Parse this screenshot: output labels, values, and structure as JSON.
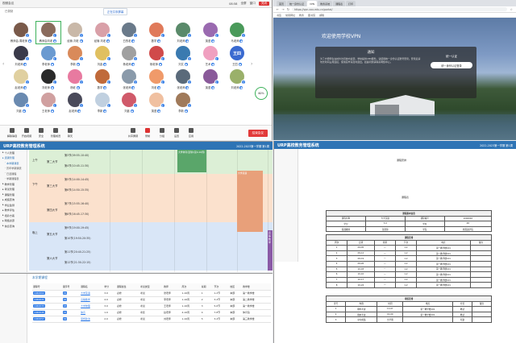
{
  "meeting": {
    "title_left": "视频会议",
    "title_time": "08:58",
    "title_buttons": [
      "全屏",
      "窗口",
      "关闭"
    ],
    "subtitle": "已录制",
    "notice": "正在共享屏幕",
    "participants": [
      {
        "name": "教师会-周老师",
        "color": "#7a5a4a",
        "badge": "主",
        "selected": false
      },
      {
        "name": "教师会刘老",
        "color": "#8a6b5c",
        "badge": "主",
        "selected": true
      },
      {
        "name": "经管-刘老",
        "color": "#c9b8a8",
        "badge": "主",
        "selected": false
      },
      {
        "name": "经管-刘老",
        "color": "#d9a0a8",
        "badge": "主",
        "selected": false
      },
      {
        "name": "白的老",
        "color": "#6a7a8a",
        "badge": "主",
        "selected": false
      },
      {
        "name": "数学",
        "color": "#e07a5a",
        "badge": "主",
        "selected": false
      },
      {
        "name": "刘老师",
        "color": "#5a8a6a",
        "badge": "主",
        "selected": false
      },
      {
        "name": "英语",
        "color": "#9a6ab0",
        "badge": "主",
        "selected": false
      },
      {
        "name": "马老师",
        "color": "#4a9a5a",
        "badge": "主",
        "selected": false
      },
      {
        "name": "刘老师",
        "color": "#3a3a4a",
        "badge": "主",
        "selected": false
      },
      {
        "name": "李老师",
        "color": "#6a9ad0",
        "badge": "主",
        "selected": false
      },
      {
        "name": "李新",
        "color": "#d98a5a",
        "badge": "主",
        "selected": false
      },
      {
        "name": "刘鑫",
        "color": "#e0c060",
        "badge": "主",
        "selected": false
      },
      {
        "name": "杨老师",
        "color": "#a0a0a0",
        "badge": "主",
        "selected": false
      },
      {
        "name": "杨老师",
        "color": "#d04a4a",
        "badge": "主",
        "selected": false
      },
      {
        "name": "刘文",
        "color": "#3a7ab0",
        "badge": "主",
        "selected": false
      },
      {
        "name": "艺术",
        "color": "#f0a0c0",
        "badge": "主",
        "selected": false
      },
      {
        "name": "王四",
        "color": "#3a6ad0",
        "badge": "主",
        "selected": false,
        "initials": "王四"
      },
      {
        "name": "赵老师",
        "color": "#e0d0a0",
        "badge": "主",
        "selected": false
      },
      {
        "name": "刘老师",
        "color": "#2a2a2a",
        "badge": "主",
        "selected": false
      },
      {
        "name": "杨老",
        "color": "#e87aa0",
        "badge": "主",
        "selected": false
      },
      {
        "name": "数学",
        "color": "#c06a3a",
        "badge": "主",
        "selected": false
      },
      {
        "name": "张老师",
        "color": "#8a9aaa",
        "badge": "主",
        "selected": false
      },
      {
        "name": "刘老",
        "color": "#f09a6a",
        "badge": "主",
        "selected": false
      },
      {
        "name": "张老师",
        "color": "#5a6a7a",
        "badge": "主",
        "selected": false
      },
      {
        "name": "英语",
        "color": "#8a5a9a",
        "badge": "主",
        "selected": false
      },
      {
        "name": "刘老师",
        "color": "#9ab06a",
        "badge": "主",
        "selected": false
      },
      {
        "name": "刘鑫",
        "color": "#6a8ab0",
        "badge": "主",
        "selected": false
      },
      {
        "name": "王老师",
        "color": "#d0a0a0",
        "badge": "主",
        "selected": false
      },
      {
        "name": "赵老师",
        "color": "#4a4a5a",
        "badge": "主",
        "selected": false
      },
      {
        "name": "李新",
        "color": "#c0d0e0",
        "badge": "主",
        "selected": false
      },
      {
        "name": "刘鑫",
        "color": "#d05a6a",
        "badge": "主",
        "selected": false
      },
      {
        "name": "英语",
        "color": "#f0c0a0",
        "badge": "主",
        "selected": false
      },
      {
        "name": "李新",
        "color": "#a07a5a",
        "badge": "主",
        "selected": false
      }
    ],
    "net_status": "60%",
    "toolbar": [
      {
        "label": "解除静音",
        "red": false
      },
      {
        "label": "开启视频",
        "red": false
      },
      {
        "label": "安全",
        "red": false
      },
      {
        "label": "管理成员",
        "red": false
      },
      {
        "label": "聊天",
        "red": false
      },
      {
        "label": "共享屏幕",
        "red": false
      },
      {
        "label": "录制",
        "red": true
      },
      {
        "label": "分组",
        "red": false
      },
      {
        "label": "设置",
        "red": false
      },
      {
        "label": "应用",
        "red": false
      }
    ],
    "end_button": "结束会议"
  },
  "browser": {
    "tabs": [
      "首页",
      "统一身份认证",
      "VPN",
      "教务系统",
      "课程表",
      "打印"
    ],
    "active_tab": 2,
    "url": "https://vpn.xxx.edu.cn/portal/",
    "bookmarks": [
      "书签",
      "常用网址",
      "教务",
      "图书馆",
      "邮箱"
    ],
    "vpn_title": "欢迎使用学校VPN",
    "notice_title": "通知",
    "notice_text": "为了方便师生在校外访问校内资源，学校提供VPN服务。请使用统一身份认证账号登录。登录后请勿长时间占用连接，使用完毕请及时退出。如遇问题请联系网络中心。",
    "login_title": "统一认证",
    "login_button": "统一身份认证登录"
  },
  "urp": {
    "logo": "URP高校教务管理系统",
    "term": "2022-2023第一学期 第1周",
    "sidebar": [
      {
        "label": "个人管理",
        "sub": false,
        "hi": false
      },
      {
        "label": "选课管理",
        "sub": false,
        "hi": true
      },
      {
        "label": "本学期课表",
        "sub": true,
        "hi": true
      },
      {
        "label": "历年学期课表",
        "sub": true,
        "hi": false
      },
      {
        "label": "已选课程",
        "sub": true,
        "hi": false
      },
      {
        "label": "学期课程表",
        "sub": true,
        "hi": false
      },
      {
        "label": "教学管理",
        "sub": false,
        "hi": false
      },
      {
        "label": "考试管理",
        "sub": false,
        "hi": false
      },
      {
        "label": "课程管理",
        "sub": false,
        "hi": false
      },
      {
        "label": "成绩查询",
        "sub": false,
        "hi": false
      },
      {
        "label": "学业监测",
        "sub": false,
        "hi": false
      },
      {
        "label": "教学评估",
        "sub": false,
        "hi": false
      },
      {
        "label": "培养方案",
        "sub": false,
        "hi": false
      },
      {
        "label": "网络资源",
        "sub": false,
        "hi": false
      },
      {
        "label": "信息查询",
        "sub": false,
        "hi": false
      }
    ],
    "sections": [
      {
        "period": "上午",
        "label": "第二大节",
        "slots": [
          "第3节(09:55-10:40)",
          "第4节(10:45-11:30)"
        ],
        "color": "#dcefd6"
      },
      {
        "period": "下午",
        "label": "第三大节",
        "slots": [
          "第5节(14:00-14:45)",
          "第6节(14:50-15:35)"
        ],
        "color": "#fbe1cd"
      },
      {
        "period": "",
        "label": "第四大节",
        "slots": [
          "第7节(15:55-16:40)",
          "第8节(16:45-17:30)"
        ],
        "color": "#fbe1cd"
      },
      {
        "period": "晚上",
        "label": "第五大节",
        "slots": [
          "第9节(19:00-19:45)",
          "第10节(19:50-20:35)"
        ],
        "color": "#d9e6f7"
      },
      {
        "period": "",
        "label": "第六大节",
        "slots": [
          "第11节(20:40-21:25)",
          "第12节(21:30-22:15)"
        ],
        "color": "#d9e6f7"
      }
    ],
    "courses": [
      {
        "title": "大学体育(篮球)(第4-16周)",
        "color": "#5aa66a"
      },
      {
        "title": "大学英语",
        "color": "#e8a07a"
      },
      {
        "title": "高等数学",
        "color": "#8a5aa6"
      }
    ]
  },
  "course_list": {
    "title": "本学期课程",
    "headers": [
      "课程号",
      "课序号",
      "课程名",
      "学分",
      "课程属性",
      "考试类型",
      "教师",
      "周次",
      "星期",
      "节次",
      "校区",
      "教学楼"
    ],
    "rows": [
      [
        "1040002",
        "01",
        "大学英语",
        "3.0",
        "必修",
        "考试",
        "张老师",
        "1-16周",
        "1",
        "1-2节",
        "本部",
        "第一教学楼"
      ],
      [
        "1040021",
        "02",
        "高等数学",
        "4.0",
        "必修",
        "考试",
        "李老师",
        "1-16周",
        "2",
        "3-4节",
        "本部",
        "第二教学楼"
      ],
      [
        "1040033",
        "03",
        "大学物理",
        "3.0",
        "必修",
        "考试",
        "王老师",
        "1-16周",
        "3",
        "5-6节",
        "本部",
        "第一教学楼"
      ],
      [
        "1040045",
        "01",
        "体育",
        "1.0",
        "必修",
        "考查",
        "赵老师",
        "4-16周",
        "4",
        "7-8节",
        "本部",
        "体育馆"
      ],
      [
        "1040057",
        "02",
        "思想政治",
        "2.0",
        "必修",
        "考试",
        "刘老师",
        "1-16周",
        "5",
        "3-4节",
        "本部",
        "第三教学楼"
      ]
    ]
  },
  "document": {
    "logo": "URP高校教务管理系统",
    "term": "2022-2023第一学期 第1周",
    "header_line": "课程安排",
    "subhead": "课程表",
    "table1": {
      "title": "课程基本信息",
      "rows": [
        [
          "课程名称",
          "大学英语",
          "课程编号",
          "1040002"
        ],
        [
          "学分",
          "3.0",
          "学时",
          "48"
        ],
        [
          "授课教师",
          "张老师",
          "学院",
          "外国语学院"
        ]
      ]
    },
    "table2": {
      "title": "课程安排",
      "headers": [
        "周次",
        "日期",
        "星期",
        "节次",
        "地点",
        "备注"
      ],
      "rows": [
        [
          "1",
          "09-05",
          "一",
          "1-2",
          "第一教学楼101",
          ""
        ],
        [
          "2",
          "09-12",
          "一",
          "1-2",
          "第一教学楼101",
          ""
        ],
        [
          "3",
          "09-19",
          "一",
          "1-2",
          "第一教学楼101",
          ""
        ],
        [
          "4",
          "09-26",
          "一",
          "1-2",
          "第一教学楼101",
          ""
        ],
        [
          "5",
          "10-03",
          "一",
          "1-2",
          "第一教学楼101",
          ""
        ],
        [
          "6",
          "10-10",
          "一",
          "1-2",
          "第一教学楼101",
          ""
        ],
        [
          "7",
          "10-17",
          "一",
          "1-2",
          "第一教学楼101",
          ""
        ],
        [
          "8",
          "10-24",
          "一",
          "1-2",
          "第一教学楼101",
          ""
        ]
      ]
    },
    "table3": {
      "title": "考核安排",
      "headers": [
        "序号",
        "内容",
        "时间",
        "地点",
        "方式",
        "备注"
      ],
      "rows": [
        [
          "1",
          "期中考试",
          "11-07",
          "第一教学楼101",
          "笔试",
          ""
        ],
        [
          "2",
          "期末考试",
          "01-09",
          "第一教学楼101",
          "笔试",
          ""
        ],
        [
          "3",
          "平时成绩",
          "全学期",
          "",
          "考勤",
          ""
        ]
      ]
    }
  }
}
